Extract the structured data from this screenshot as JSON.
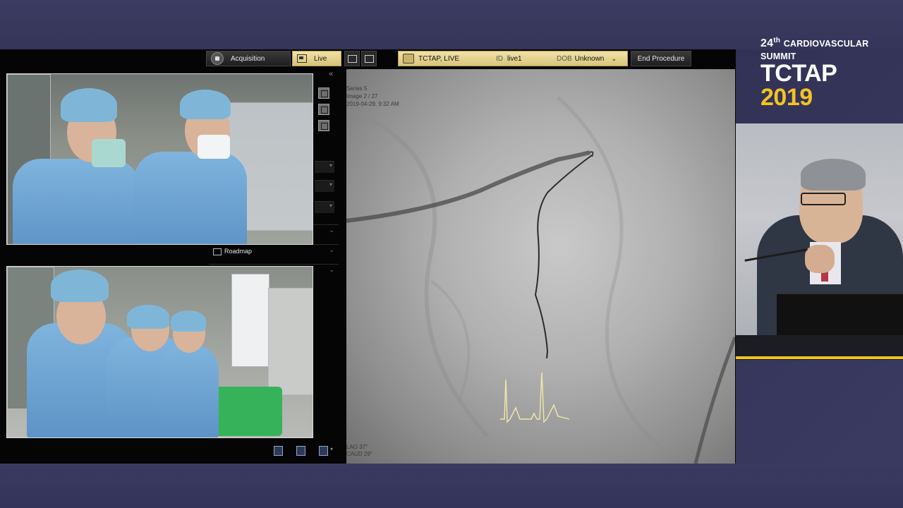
{
  "summit": {
    "edition": "24",
    "edition_suffix": "th",
    "subtitle": "CARDIOVASCULAR SUMMIT",
    "name": "TCTAP",
    "year": "2019"
  },
  "console": {
    "tabs": {
      "acquisition": "Acquisition",
      "live": "Live"
    },
    "patient": {
      "name": "TCTAP, LIVE",
      "id_label": "ID",
      "id": "live1",
      "dob_label": "DOB",
      "dob": "Unknown"
    },
    "end_procedure": "End Procedure",
    "sections": {
      "roadmap": "Roadmap"
    },
    "fluoro": {
      "series": "Series 5",
      "image": "Image 2 / 27",
      "timestamp": "2019-04-29, 9:32 AM",
      "angle_1_label": "LAO",
      "angle_1_value": "37°",
      "angle_2_label": "CAUD",
      "angle_2_value": "29°"
    }
  },
  "colors": {
    "brand_yellow": "#f4c322",
    "live_tab": "#e6d391",
    "ecg_trace": "#f2e9a8"
  }
}
